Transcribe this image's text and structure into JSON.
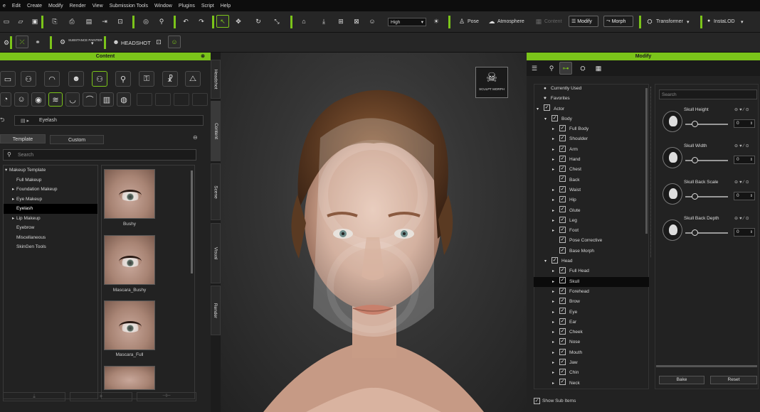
{
  "menu": [
    "e",
    "Edit",
    "Create",
    "Modify",
    "Render",
    "View",
    "Submission Tools",
    "Window",
    "Plugins",
    "Script",
    "Help"
  ],
  "toolbar": {
    "quality": "High",
    "pose": "Pose",
    "atmosphere": "Atmosphere",
    "content": "Content",
    "modify": "Modify",
    "morph": "Morph",
    "transformer": "Transformer",
    "instaloo": "InstaLOD",
    "substance": "SUBSTANCE PAINTER",
    "headshot": "HEADSHOT"
  },
  "content_panel": {
    "title": "Content",
    "path": "Eyelash",
    "tabs": [
      "Template",
      "Custom"
    ],
    "search_placeholder": "Search",
    "tree": [
      {
        "label": "Makeup Template",
        "arrow": "▾",
        "indent": 0
      },
      {
        "label": "Full Makeup",
        "arrow": "",
        "indent": 1
      },
      {
        "label": "Foundation Makeup",
        "arrow": "▸",
        "indent": 1
      },
      {
        "label": "Eye Makeup",
        "arrow": "▸",
        "indent": 1
      },
      {
        "label": "Eyelash",
        "arrow": "",
        "indent": 1,
        "selected": true
      },
      {
        "label": "Lip Makeup",
        "arrow": "▸",
        "indent": 1
      },
      {
        "label": "Eyebrow",
        "arrow": "",
        "indent": 1
      },
      {
        "label": "Miscellaneous",
        "arrow": "",
        "indent": 1
      },
      {
        "label": "SkinGen Tools",
        "arrow": "",
        "indent": 1
      }
    ],
    "thumbs": [
      "Bushy",
      "Mascara_Bushy",
      "Mascara_Full"
    ]
  },
  "side_tabs": [
    "Headshot",
    "Content",
    "Scene",
    "Visual",
    "Render"
  ],
  "viewport": {
    "badge": "SCULPT MORPH"
  },
  "modify_panel": {
    "title": "Modify",
    "search_placeholder": "Search",
    "tree": [
      {
        "label": "Currently Used",
        "kind": "dot",
        "indent": 0
      },
      {
        "label": "Favorites",
        "kind": "heart",
        "indent": 0
      },
      {
        "label": "Actor",
        "kind": "check",
        "arrow": "▾",
        "indent": 0
      },
      {
        "label": "Body",
        "kind": "check",
        "arrow": "▾",
        "indent": 1
      },
      {
        "label": "Full Body",
        "kind": "check",
        "arrow": "▸",
        "indent": 2
      },
      {
        "label": "Shoulder",
        "kind": "check",
        "arrow": "▸",
        "indent": 2
      },
      {
        "label": "Arm",
        "kind": "check",
        "arrow": "▸",
        "indent": 2
      },
      {
        "label": "Hand",
        "kind": "check",
        "arrow": "▸",
        "indent": 2
      },
      {
        "label": "Chest",
        "kind": "check",
        "arrow": "▸",
        "indent": 2
      },
      {
        "label": "Back",
        "kind": "check",
        "arrow": "",
        "indent": 2
      },
      {
        "label": "Waist",
        "kind": "check",
        "arrow": "▸",
        "indent": 2
      },
      {
        "label": "Hip",
        "kind": "check",
        "arrow": "▸",
        "indent": 2
      },
      {
        "label": "Glute",
        "kind": "check",
        "arrow": "▸",
        "indent": 2
      },
      {
        "label": "Leg",
        "kind": "check",
        "arrow": "▸",
        "indent": 2
      },
      {
        "label": "Foot",
        "kind": "check",
        "arrow": "▸",
        "indent": 2
      },
      {
        "label": "Pose Corrective",
        "kind": "check",
        "arrow": "",
        "indent": 2
      },
      {
        "label": "Base Morph",
        "kind": "check",
        "arrow": "",
        "indent": 2
      },
      {
        "label": "Head",
        "kind": "check",
        "arrow": "▾",
        "indent": 1
      },
      {
        "label": "Full Head",
        "kind": "check",
        "arrow": "▸",
        "indent": 2
      },
      {
        "label": "Skull",
        "kind": "check",
        "arrow": "▸",
        "indent": 2,
        "selected": true
      },
      {
        "label": "Forehead",
        "kind": "check",
        "arrow": "▸",
        "indent": 2
      },
      {
        "label": "Brow",
        "kind": "check",
        "arrow": "▸",
        "indent": 2
      },
      {
        "label": "Eye",
        "kind": "check",
        "arrow": "▸",
        "indent": 2
      },
      {
        "label": "Ear",
        "kind": "check",
        "arrow": "▸",
        "indent": 2
      },
      {
        "label": "Cheek",
        "kind": "check",
        "arrow": "▸",
        "indent": 2
      },
      {
        "label": "Nose",
        "kind": "check",
        "arrow": "▸",
        "indent": 2
      },
      {
        "label": "Mouth",
        "kind": "check",
        "arrow": "▸",
        "indent": 2
      },
      {
        "label": "Jaw",
        "kind": "check",
        "arrow": "▸",
        "indent": 2
      },
      {
        "label": "Chin",
        "kind": "check",
        "arrow": "▸",
        "indent": 2
      },
      {
        "label": "Neck",
        "kind": "check",
        "arrow": "▸",
        "indent": 2
      }
    ],
    "sliders": [
      {
        "label": "Skull Height",
        "value": "0"
      },
      {
        "label": "Skull Width",
        "value": "0"
      },
      {
        "label": "Skull Back Scale",
        "value": "0"
      },
      {
        "label": "Skull Back Depth",
        "value": "0"
      }
    ],
    "show_sub_items": "Show Sub Items",
    "bake": "Bake",
    "reset": "Reset"
  },
  "colors": {
    "accent": "#7bc41a",
    "panel": "#222222",
    "toolbar": "#262626"
  }
}
